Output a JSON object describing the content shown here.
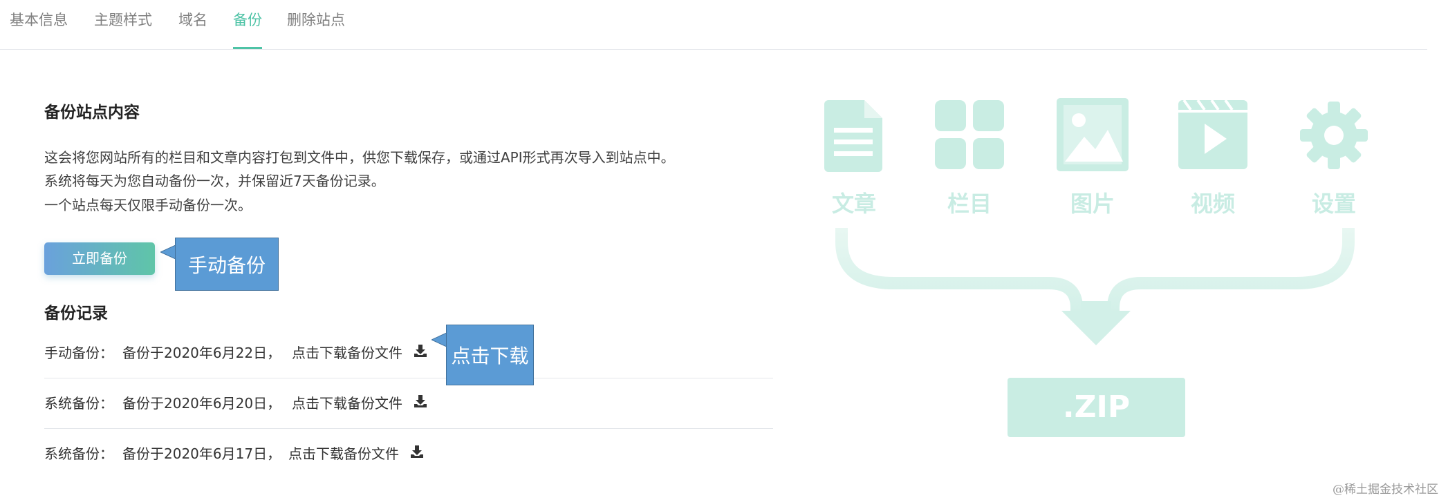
{
  "tabs": [
    {
      "label": "基本信息",
      "active": false
    },
    {
      "label": "主题样式",
      "active": false
    },
    {
      "label": "域名",
      "active": false
    },
    {
      "label": "备份",
      "active": true
    },
    {
      "label": "删除站点",
      "active": false
    }
  ],
  "backup": {
    "title": "备份站点内容",
    "description": [
      "这会将您网站所有的栏目和文章内容打包到文件中，供您下载保存，或通过API形式再次导入到站点中。",
      "系统将每天为您自动备份一次，并保留近7天备份记录。",
      "一个站点每天仅限手动备份一次。"
    ],
    "button_label": "立即备份"
  },
  "callouts": {
    "manual": "手动备份",
    "download": "点击下载"
  },
  "records": {
    "title": "备份记录",
    "items": [
      {
        "type": "手动备份：",
        "date": "备份于2020年6月22日，",
        "link": "点击下载备份文件"
      },
      {
        "type": "系统备份：",
        "date": "备份于2020年6月20日，",
        "link": "点击下载备份文件"
      },
      {
        "type": "系统备份：",
        "date": "备份于2020年6月17日，",
        "link": "点击下载备份文件"
      }
    ]
  },
  "illustration": {
    "items": [
      {
        "label": "文章",
        "icon": "document-icon"
      },
      {
        "label": "栏目",
        "icon": "grid-icon"
      },
      {
        "label": "图片",
        "icon": "image-icon"
      },
      {
        "label": "视频",
        "icon": "video-icon"
      },
      {
        "label": "设置",
        "icon": "gear-icon"
      }
    ],
    "zip_label": ".ZIP"
  },
  "watermark": "@稀土掘金技术社区",
  "colors": {
    "accent": "#4ec3a6",
    "callout": "#5b9bd5",
    "illustration": "#c9ede3"
  }
}
